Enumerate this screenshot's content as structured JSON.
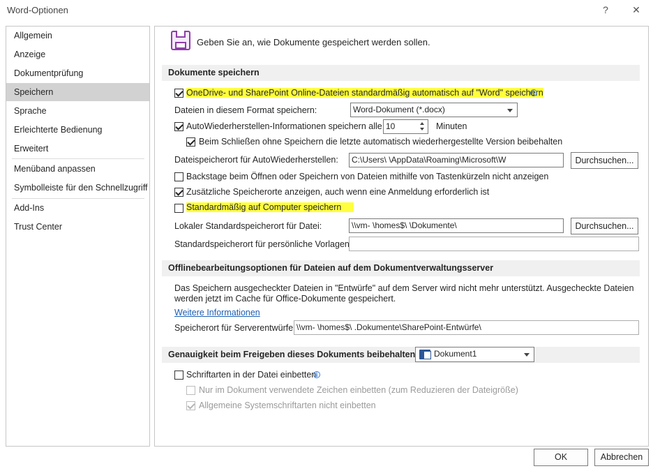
{
  "window": {
    "title": "Word-Optionen",
    "help_glyph": "?",
    "close_glyph": "✕"
  },
  "sidebar": {
    "items": [
      {
        "label": "Allgemein"
      },
      {
        "label": "Anzeige"
      },
      {
        "label": "Dokumentprüfung"
      },
      {
        "label": "Speichern",
        "selected": true
      },
      {
        "label": "Sprache"
      },
      {
        "label": "Erleichterte Bedienung"
      },
      {
        "label": "Erweitert"
      },
      {
        "label": "Menüband anpassen"
      },
      {
        "label": "Symbolleiste für den Schnellzugriff"
      },
      {
        "label": "Add-Ins"
      },
      {
        "label": "Trust Center"
      }
    ]
  },
  "header": {
    "icon": "save-icon",
    "text": "Geben Sie an, wie Dokumente gespeichert werden sollen."
  },
  "save_section": {
    "title": "Dokumente speichern",
    "onedrive": {
      "label": "OneDrive- und SharePoint Online-Dateien standardmäßig automatisch auf \"Word\" speichern",
      "checked": true,
      "highlighted": true
    },
    "format_label": "Dateien in diesem Format speichern:",
    "format_value": "Word-Dokument (*.docx)",
    "autorecover": {
      "label": "AutoWiederherstellen-Informationen speichern alle",
      "checked": true
    },
    "autorecover_minutes": "10",
    "minutes_label": "Minuten",
    "keep_last": {
      "label": "Beim Schließen ohne Speichern die letzte automatisch wiederhergestellte Version beibehalten",
      "checked": true
    },
    "autorecover_path_label": "Dateispeicherort für AutoWiederherstellen:",
    "autorecover_path_value": "C:\\Users\\                         \\AppData\\Roaming\\Microsoft\\W",
    "browse_label": "Durchsuchen...",
    "backstage": {
      "label": "Backstage beim Öffnen oder Speichern von Dateien mithilfe von Tastenkürzeln nicht anzeigen",
      "checked": false
    },
    "additional_places": {
      "label": "Zusätzliche Speicherorte anzeigen, auch wenn eine Anmeldung erforderlich ist",
      "checked": true
    },
    "default_computer": {
      "label": "Standardmäßig auf Computer speichern",
      "checked": false,
      "highlighted": true
    },
    "local_default_label": "Lokaler Standardspeicherort für Datei:",
    "local_default_value": "\\\\vm-                 \\homes$\\                         \\Dokumente\\",
    "personal_templates_label": "Standardspeicherort für persönliche Vorlagen:",
    "personal_templates_value": ""
  },
  "offline_section": {
    "title": "Offlinebearbeitungsoptionen für Dateien auf dem Dokumentverwaltungsserver",
    "description": "Das Speichern ausgecheckter Dateien in \"Entwürfe\" auf dem Server wird nicht mehr unterstützt. Ausgecheckte Dateien werden jetzt im Cache für Office-Dokumente gespeichert.",
    "more_info_link": "Weitere Informationen",
    "drafts_label": "Speicherort für Serverentwürfe:",
    "drafts_value": "\\\\vm-                 \\homes$\\                         .Dokumente\\SharePoint-Entwürfe\\"
  },
  "fidelity_section": {
    "title": "Genauigkeit beim Freigeben dieses Dokuments beibehalten:",
    "document_value": "Dokument1",
    "embed_fonts": {
      "label": "Schriftarten in der Datei einbetten",
      "checked": false
    },
    "only_used_chars": {
      "label": "Nur im Dokument verwendete Zeichen einbetten (zum Reduzieren der Dateigröße)",
      "checked": false,
      "disabled": true
    },
    "no_system_fonts": {
      "label": "Allgemeine Systemschriftarten nicht einbetten",
      "checked": true,
      "disabled": true
    }
  },
  "footer": {
    "ok_label": "OK",
    "cancel_label": "Abbrechen"
  },
  "colors": {
    "highlight": "#ffff3d",
    "selected_nav": "#d2d2d2",
    "section_bg": "#f0f0f0",
    "link": "#1d5fb3",
    "accent_purple": "#8f3ea8"
  }
}
